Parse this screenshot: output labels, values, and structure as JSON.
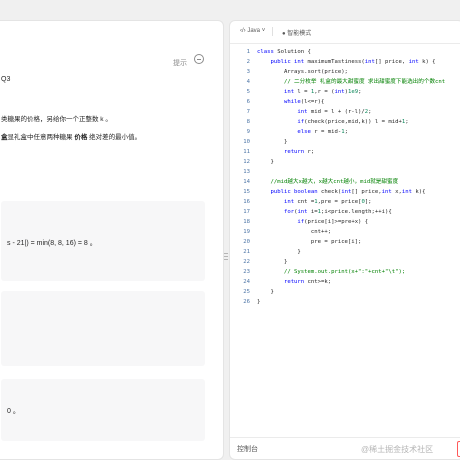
{
  "left": {
    "hint_label": "提示",
    "qnum": "Q3",
    "desc_line1": "类糖果的价格，另给你一个正整数 k 。",
    "desc_line2_pre": "盒",
    "desc_line2_mid": "显礼盒中任意两种糖果",
    "desc_line2_bold": "价格",
    "desc_line2_post": "绝对差的最小值。",
    "example1_text": "s - 21|) = min(8, 8, 16) = 8 。",
    "example3_text": "0 。"
  },
  "editor": {
    "language": "Java",
    "mode": "智能模式",
    "lines": [
      {
        "n": "1",
        "html": "<span class=\"kw\">class</span> Solution {"
      },
      {
        "n": "2",
        "html": "    <span class=\"kw\">public int</span> maximumTastiness(<span class=\"kw\">int</span>[] price, <span class=\"kw\">int</span> k) {"
      },
      {
        "n": "3",
        "html": "        Arrays.sort(price);"
      },
      {
        "n": "4",
        "html": "        <span class=\"cm\">// 二分枚举 礼盒的最大甜蜜度 求出甜蜜度下能选出的个数cnt</span>"
      },
      {
        "n": "5",
        "html": "        <span class=\"kw\">int</span> l = <span class=\"num\">1</span>,r = (<span class=\"kw\">int</span>)<span class=\"num\">1e9</span>;"
      },
      {
        "n": "6",
        "html": "        <span class=\"kw\">while</span>(l&lt;=r){"
      },
      {
        "n": "7",
        "html": "            <span class=\"kw\">int</span> mid = l + (r-l)/<span class=\"num\">2</span>;"
      },
      {
        "n": "8",
        "html": "            <span class=\"kw\">if</span>(check(price,mid,k)) l = mid+<span class=\"num\">1</span>;"
      },
      {
        "n": "9",
        "html": "            <span class=\"kw\">else</span> r = mid-<span class=\"num\">1</span>;"
      },
      {
        "n": "10",
        "html": "        }"
      },
      {
        "n": "11",
        "html": "        <span class=\"kw\">return</span> r;"
      },
      {
        "n": "12",
        "html": "    }"
      },
      {
        "n": "13",
        "html": ""
      },
      {
        "n": "14",
        "html": "    <span class=\"cm\">//mid越大x越大，x越大cnt越小，mid就是甜蜜度</span>"
      },
      {
        "n": "15",
        "html": "    <span class=\"kw\">public boolean</span> check(<span class=\"kw\">int</span>[] price,<span class=\"kw\">int</span> x,<span class=\"kw\">int</span> k){"
      },
      {
        "n": "16",
        "html": "        <span class=\"kw\">int</span> cnt =<span class=\"num\">1</span>,pre = price[<span class=\"num\">0</span>];"
      },
      {
        "n": "17",
        "html": "        <span class=\"kw\">for</span>(<span class=\"kw\">int</span> i=<span class=\"num\">1</span>;i&lt;price.length;++i){"
      },
      {
        "n": "18",
        "html": "            <span class=\"kw\">if</span>(price[i]&gt;=pre+x) {"
      },
      {
        "n": "19",
        "html": "                cnt++;"
      },
      {
        "n": "20",
        "html": "                pre = price[i];"
      },
      {
        "n": "21",
        "html": "            }"
      },
      {
        "n": "22",
        "html": "        }"
      },
      {
        "n": "23",
        "html": "        <span class=\"cm\">// System.out.print(x+\":\"+cnt+\"\\t\");</span>"
      },
      {
        "n": "24",
        "html": "        <span class=\"kw\">return</span> cnt&gt;=k;"
      },
      {
        "n": "25",
        "html": "    }"
      },
      {
        "n": "26",
        "html": "}"
      }
    ]
  },
  "console": {
    "label": "控制台",
    "watermark": "@稀土掘金技术社区",
    "run_label": "00"
  }
}
